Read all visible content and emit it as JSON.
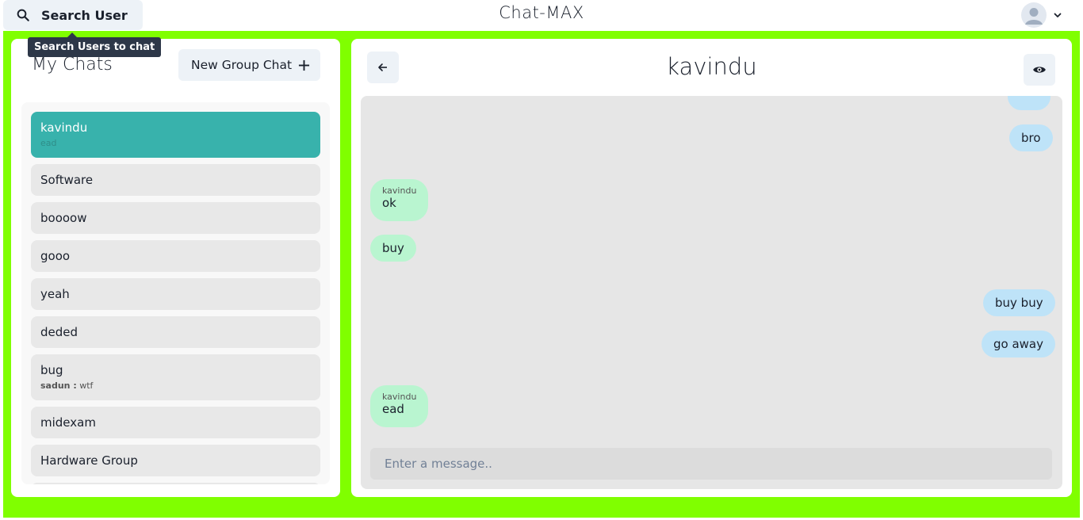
{
  "header": {
    "search_label": "Search User",
    "search_tooltip": "Search Users to chat",
    "app_title": "Chat-MAX",
    "icons": {
      "search": "search-icon",
      "avatar": "user-avatar-icon",
      "menu": "chevron-down-icon"
    }
  },
  "sidebar": {
    "title": "My Chats",
    "new_group_label": "New Group Chat",
    "chats": [
      {
        "name": "kavindu",
        "preview_text": "ead",
        "active": true
      },
      {
        "name": "Software"
      },
      {
        "name": "boooow"
      },
      {
        "name": "gooo"
      },
      {
        "name": "yeah"
      },
      {
        "name": "deded"
      },
      {
        "name": "bug",
        "preview_sender": "sadun :",
        "preview_text": "wtf"
      },
      {
        "name": "midexam"
      },
      {
        "name": "Hardware Group"
      }
    ]
  },
  "chat": {
    "title": "kavindu",
    "messages": [
      {
        "type": "sent",
        "text": "bro"
      },
      {
        "type": "received",
        "sender": "kavindu",
        "text": "ok"
      },
      {
        "type": "received",
        "text": "buy"
      },
      {
        "type": "sent",
        "text": "buy buy"
      },
      {
        "type": "sent",
        "text": "go away"
      },
      {
        "type": "received",
        "sender": "kavindu",
        "text": "ead"
      }
    ],
    "input_placeholder": "Enter a message.."
  },
  "colors": {
    "frame": "#80ff00",
    "active_chat": "#38b2ac",
    "sent_bubble": "#bee3f8",
    "received_bubble": "#b9f5d0"
  }
}
